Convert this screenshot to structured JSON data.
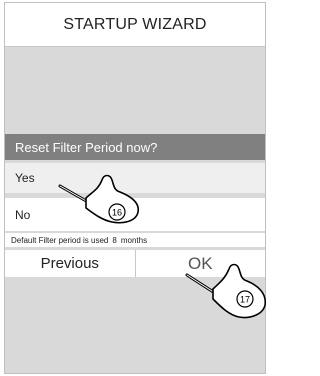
{
  "title": "STARTUP WIZARD",
  "question": "Reset Filter Period now?",
  "options": [
    {
      "label": "Yes"
    },
    {
      "label": "No"
    }
  ],
  "info": {
    "text": "Default Filter period is used",
    "value": "8",
    "unit": "months"
  },
  "nav": {
    "previous_label": "Previous",
    "ok_label": "OK"
  },
  "callouts": {
    "step_a": "16",
    "step_b": "17"
  },
  "colors": {
    "screen_bg": "#d9d9d9",
    "question_bar": "#808080",
    "selected_row": "#efefef"
  }
}
